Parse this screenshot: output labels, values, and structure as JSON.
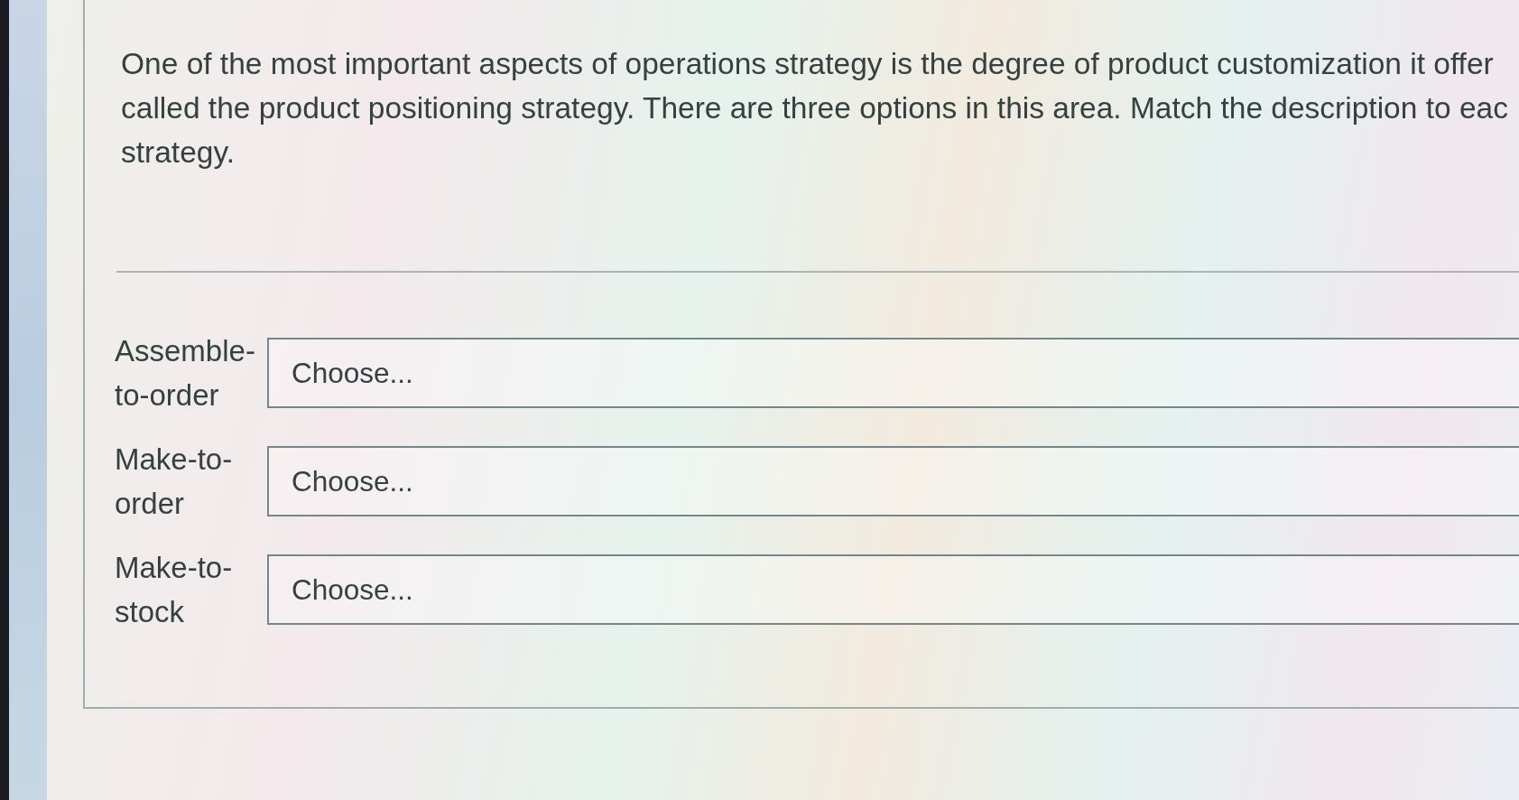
{
  "question": {
    "lines": [
      "One of the most important aspects of operations strategy is the degree of product customization it offer",
      "called the product positioning strategy. There are three options in this area. Match the description to eac",
      "strategy."
    ]
  },
  "matches": [
    {
      "label": "Assemble-to-order",
      "choice": "Choose..."
    },
    {
      "label": "Make-to-order",
      "choice": "Choose..."
    },
    {
      "label": "Make-to-stock",
      "choice": "Choose..."
    }
  ]
}
